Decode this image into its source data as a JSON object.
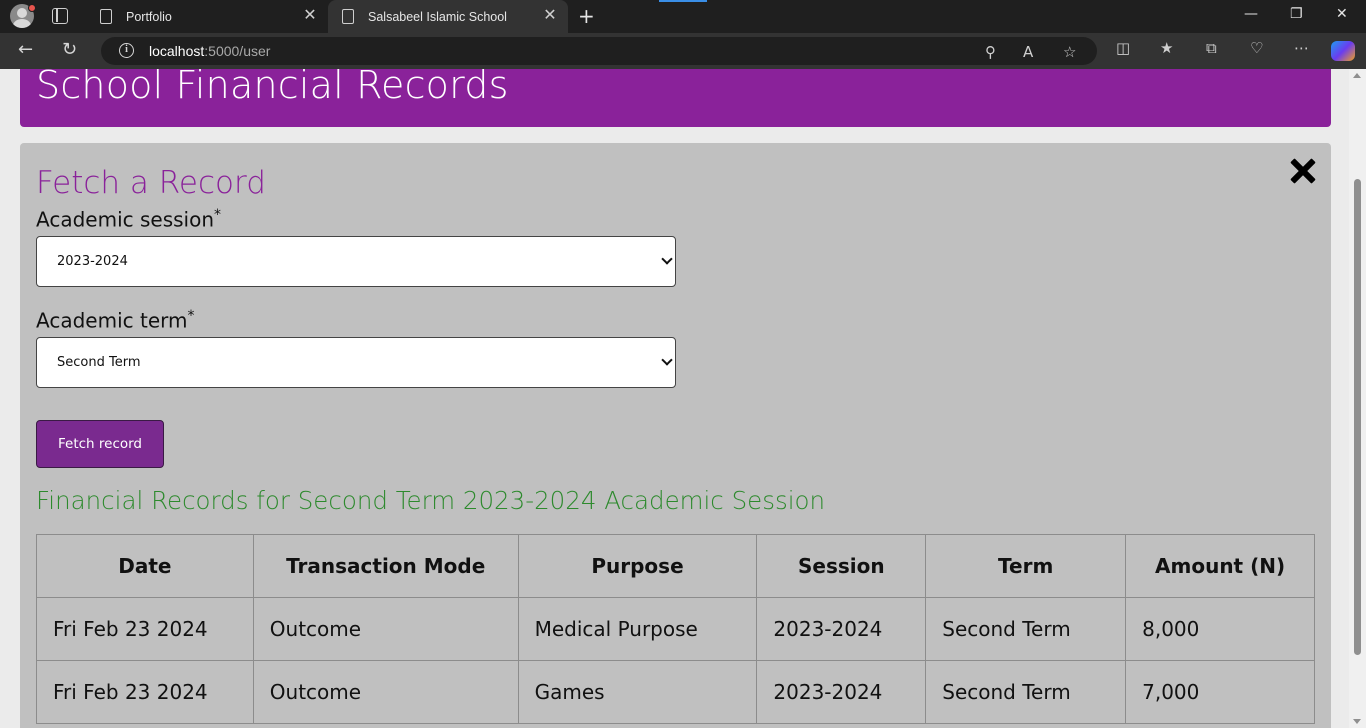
{
  "browser": {
    "tabs": [
      {
        "title": "Portfolio",
        "active": false
      },
      {
        "title": "Salsabeel Islamic School",
        "active": true
      }
    ],
    "url_host": "localhost",
    "url_path": ":5000/user",
    "close_glyph": "✕",
    "new_tab_glyph": "+",
    "window_controls": {
      "minimize": "—",
      "restore": "❐",
      "close": "✕"
    }
  },
  "page": {
    "banner_title": "School Financial Records",
    "form": {
      "heading": "Fetch a Record",
      "session_label": "Academic session",
      "term_label": "Academic term",
      "required_mark": "*",
      "session_value": "2023-2024",
      "term_value": "Second Term",
      "submit_label": "Fetch record"
    },
    "results": {
      "title": "Financial Records for Second Term 2023-2024 Academic Session",
      "columns": [
        "Date",
        "Transaction Mode",
        "Purpose",
        "Session",
        "Term",
        "Amount (N)"
      ],
      "rows": [
        [
          "Fri Feb 23 2024",
          "Outcome",
          "Medical Purpose",
          "2023-2024",
          "Second Term",
          "8,000"
        ],
        [
          "Fri Feb 23 2024",
          "Outcome",
          "Games",
          "2023-2024",
          "Second Term",
          "7,000"
        ]
      ]
    }
  },
  "colors": {
    "brand_purple": "#8a229a",
    "button_purple": "#7a2a8f",
    "results_green": "#2d8a2d",
    "panel_gray": "#c0c0c0"
  }
}
